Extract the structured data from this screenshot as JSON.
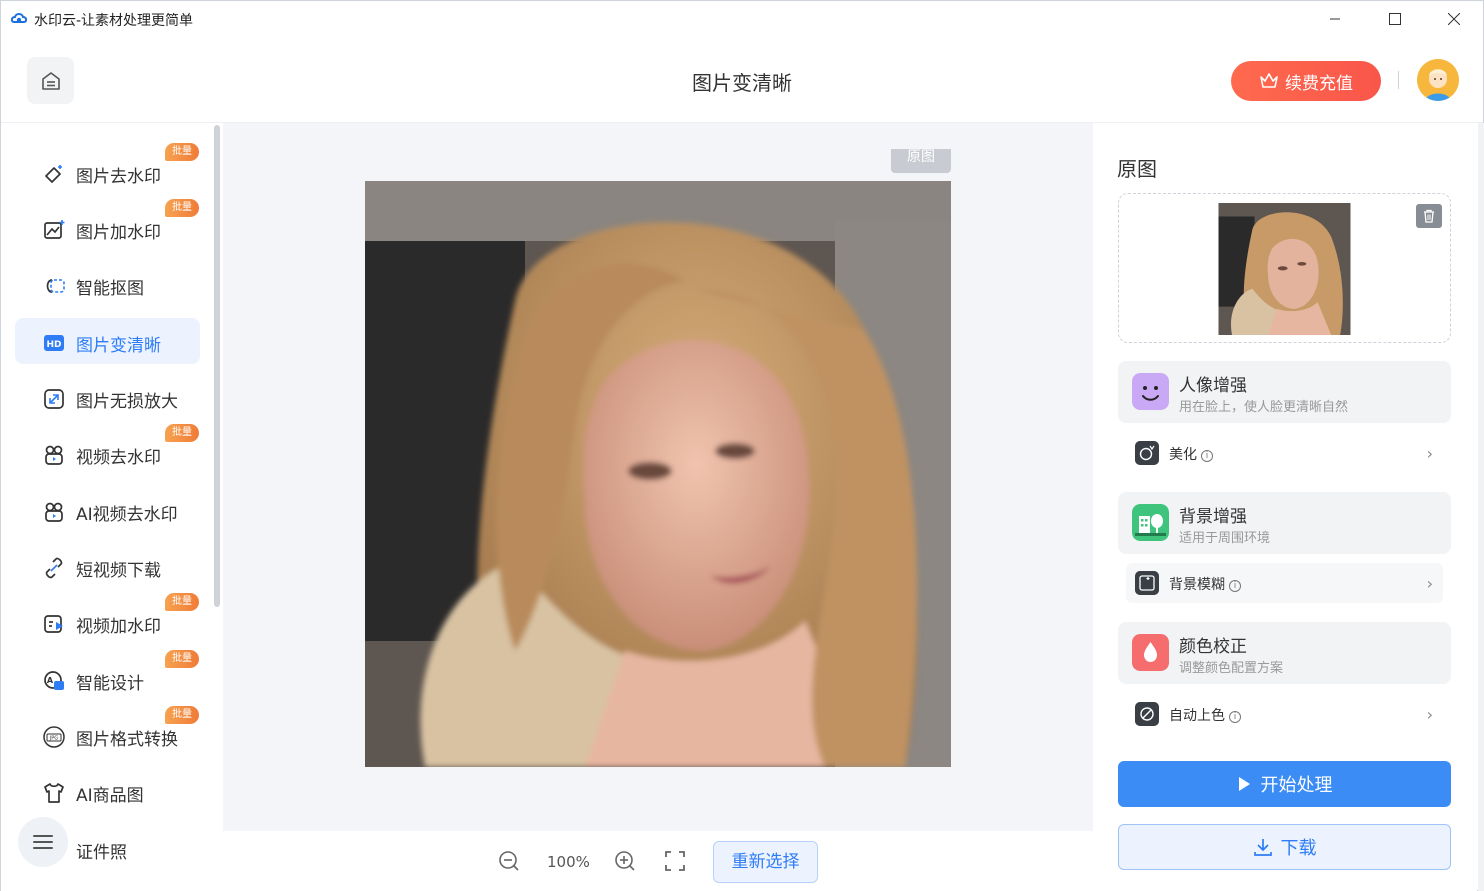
{
  "window": {
    "title": "水印云-让素材处理更简单",
    "controls": [
      "minimize-icon",
      "maximize-icon",
      "close-icon"
    ]
  },
  "header": {
    "page_title": "图片变清晰",
    "vip_label": "续费充值"
  },
  "sidebar": {
    "items": [
      {
        "label": "图片去水印",
        "icon": "eraser-icon",
        "badge": "批量"
      },
      {
        "label": "图片加水印",
        "icon": "image-add-icon",
        "badge": "批量"
      },
      {
        "label": "智能抠图",
        "icon": "cutout-icon",
        "badge": ""
      },
      {
        "label": "图片变清晰",
        "icon": "hd-icon",
        "badge": "",
        "active": true
      },
      {
        "label": "图片无损放大",
        "icon": "enlarge-icon",
        "badge": ""
      },
      {
        "label": "视频去水印",
        "icon": "video-eraser-icon",
        "badge": "批量"
      },
      {
        "label": "AI视频去水印",
        "icon": "ai-video-eraser-icon",
        "badge": ""
      },
      {
        "label": "短视频下载",
        "icon": "link-download-icon",
        "badge": ""
      },
      {
        "label": "视频加水印",
        "icon": "video-add-icon",
        "badge": "批量"
      },
      {
        "label": "智能设计",
        "icon": "design-icon",
        "badge": "批量"
      },
      {
        "label": "图片格式转换",
        "icon": "jpg-convert-icon",
        "badge": "批量"
      },
      {
        "label": "AI商品图",
        "icon": "tshirt-icon",
        "badge": ""
      },
      {
        "label": "证件照",
        "icon": "id-photo-icon",
        "badge": ""
      }
    ]
  },
  "canvas": {
    "original_tag": "原图",
    "zoom_level": "100%",
    "reselect_label": "重新选择"
  },
  "right_panel": {
    "title": "原图",
    "groups": [
      {
        "title": "人像增强",
        "subtitle": "用在脸上，使人脸更清晰自然",
        "icon": "face-icon",
        "color": "#c9a8f5",
        "option": {
          "label": "美化",
          "icon": "beauty-icon"
        }
      },
      {
        "title": "背景增强",
        "subtitle": "适用于周围环境",
        "icon": "building-tree-icon",
        "color": "#3fc47e",
        "option": {
          "label": "背景模糊",
          "icon": "blur-icon"
        }
      },
      {
        "title": "颜色校正",
        "subtitle": "调整颜色配置方案",
        "icon": "drop-icon",
        "color": "#f56d6d",
        "option": {
          "label": "自动上色",
          "icon": "colorize-icon"
        }
      }
    ],
    "start_label": "开始处理",
    "download_label": "下载"
  },
  "colors": {
    "accent": "#2e7cf6",
    "primary_button": "#3b8cf5",
    "vip": "#f9564a",
    "badge": "#f07b38"
  }
}
